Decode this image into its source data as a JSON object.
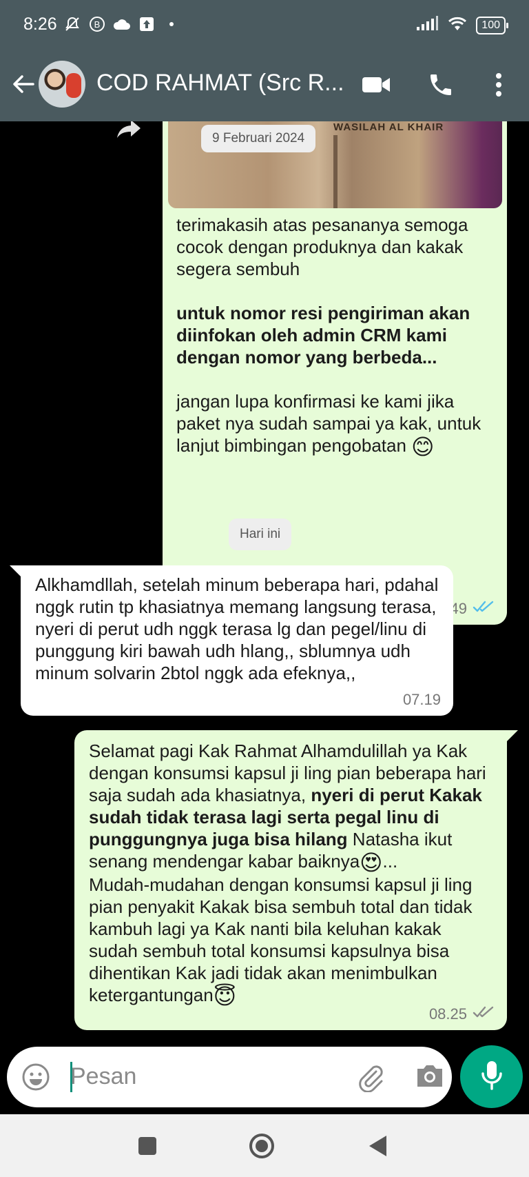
{
  "status_bar": {
    "time": "8:26",
    "icons": [
      "bell-off-icon",
      "b-badge-icon",
      "cloud-icon",
      "upload-icon",
      "dot-icon"
    ],
    "battery": "100"
  },
  "header": {
    "contact_name": "COD RAHMAT (Src R...",
    "icons": [
      "back-arrow-icon",
      "video-call-icon",
      "phone-icon",
      "more-vert-icon"
    ]
  },
  "chat": {
    "date_chip": "9 Februari 2024",
    "photo_label": "WASILAH AL KHAIR",
    "outgoing_1": {
      "para1": "terimakasih atas pesananya semoga cocok dengan produknya dan  kakak segera sembuh",
      "para2": "untuk nomor resi pengiriman akan diinfokan oleh admin CRM kami dengan nomor yang berbeda...",
      "para3": "jangan lupa konfirmasi ke kami jika paket nya sudah sampai ya kak, untuk lanjut bimbingan pengobatan",
      "emoji": "😊",
      "time": "21.49",
      "status_color": "#53bdeb"
    },
    "today_chip": "Hari ini",
    "incoming_1": {
      "text": "Alkhamdllah,  setelah minum beberapa hari, pdahal nggk rutin tp khasiatnya memang langsung terasa, nyeri di perut udh nggk terasa lg dan pegel/linu di punggung kiri bawah udh hlang,, sblumnya udh minum solvarin 2btol nggk ada efeknya,,",
      "time": "07.19"
    },
    "outgoing_2": {
      "part1": "Selamat pagi Kak Rahmat Alhamdulillah ya Kak dengan konsumsi kapsul ji ling pian beberapa hari saja sudah ada khasiatnya, ",
      "bold": "nyeri di perut Kakak sudah tidak terasa lagi serta pegal linu di punggungnya juga bisa hilang",
      "part2": " Natasha ikut senang mendengar kabar baiknya",
      "emoji1": "😍",
      "part3": "...",
      "part4": "Mudah-mudahan dengan konsumsi kapsul ji ling pian  penyakit Kakak bisa sembuh total dan tidak kambuh lagi ya Kak nanti bila keluhan kakak sudah sembuh total konsumsi kapsulnya bisa dihentikan Kak jadi tidak akan menimbulkan ketergantungan",
      "emoji2": "😇",
      "time": "08.25",
      "status_color": "#8a8a8a"
    }
  },
  "input": {
    "placeholder": "Pesan"
  },
  "accent": "#00a884",
  "header_color": "#4a5a5f"
}
